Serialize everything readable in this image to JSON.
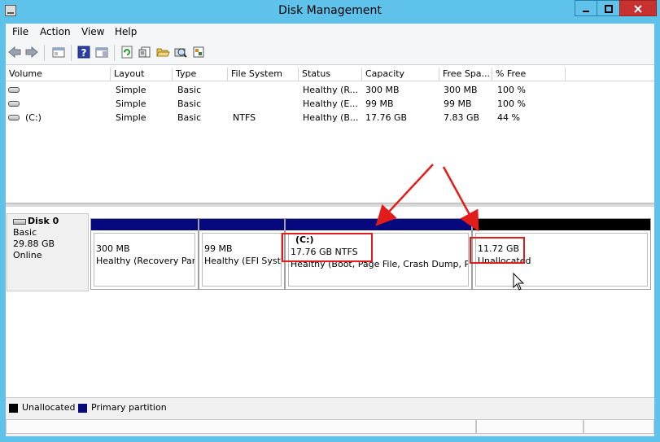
{
  "window": {
    "title": "Disk Management"
  },
  "menu": [
    "File",
    "Action",
    "View",
    "Help"
  ],
  "toolbar": {
    "icons": [
      "back-icon",
      "forward-icon",
      "console-tree-icon",
      "help-icon",
      "action-pane-icon",
      "refresh-icon",
      "properties-icon",
      "open-icon",
      "rescan-disks-icon",
      "settings-icon"
    ]
  },
  "volume_list": {
    "columns": [
      "Volume",
      "Layout",
      "Type",
      "File System",
      "Status",
      "Capacity",
      "Free Spa...",
      "% Free"
    ],
    "rows": [
      {
        "volume": "",
        "layout": "Simple",
        "type": "Basic",
        "fs": "",
        "status": "Healthy (R...",
        "capacity": "300 MB",
        "free": "300 MB",
        "pct": "100 %"
      },
      {
        "volume": "",
        "layout": "Simple",
        "type": "Basic",
        "fs": "",
        "status": "Healthy (E...",
        "capacity": "99 MB",
        "free": "99 MB",
        "pct": "100 %"
      },
      {
        "volume": "(C:)",
        "layout": "Simple",
        "type": "Basic",
        "fs": "NTFS",
        "status": "Healthy (B...",
        "capacity": "17.76 GB",
        "free": "7.83 GB",
        "pct": "44 %"
      }
    ]
  },
  "disk": {
    "name": "Disk 0",
    "type": "Basic",
    "size": "29.88 GB",
    "state": "Online",
    "partitions": [
      {
        "title": "",
        "size": "300 MB",
        "status": "Healthy (Recovery Par",
        "bar": "primary"
      },
      {
        "title": "",
        "size": "99 MB",
        "status": "Healthy (EFI Syste",
        "bar": "primary"
      },
      {
        "title": "(C:)",
        "size": "17.76 GB NTFS",
        "status": "Healthy (Boot, Page File, Crash Dump, Pr",
        "bar": "primary"
      },
      {
        "title": "",
        "size": "11.72 GB",
        "status": "Unallocated",
        "bar": "unallocated"
      }
    ]
  },
  "legend": [
    {
      "label": "Unallocated",
      "color": "#000000"
    },
    {
      "label": "Primary partition",
      "color": "#05097d"
    }
  ],
  "colors": {
    "annotation": "#e21b1b",
    "titlebar": "#5ec2eb",
    "close": "#c7312e"
  }
}
